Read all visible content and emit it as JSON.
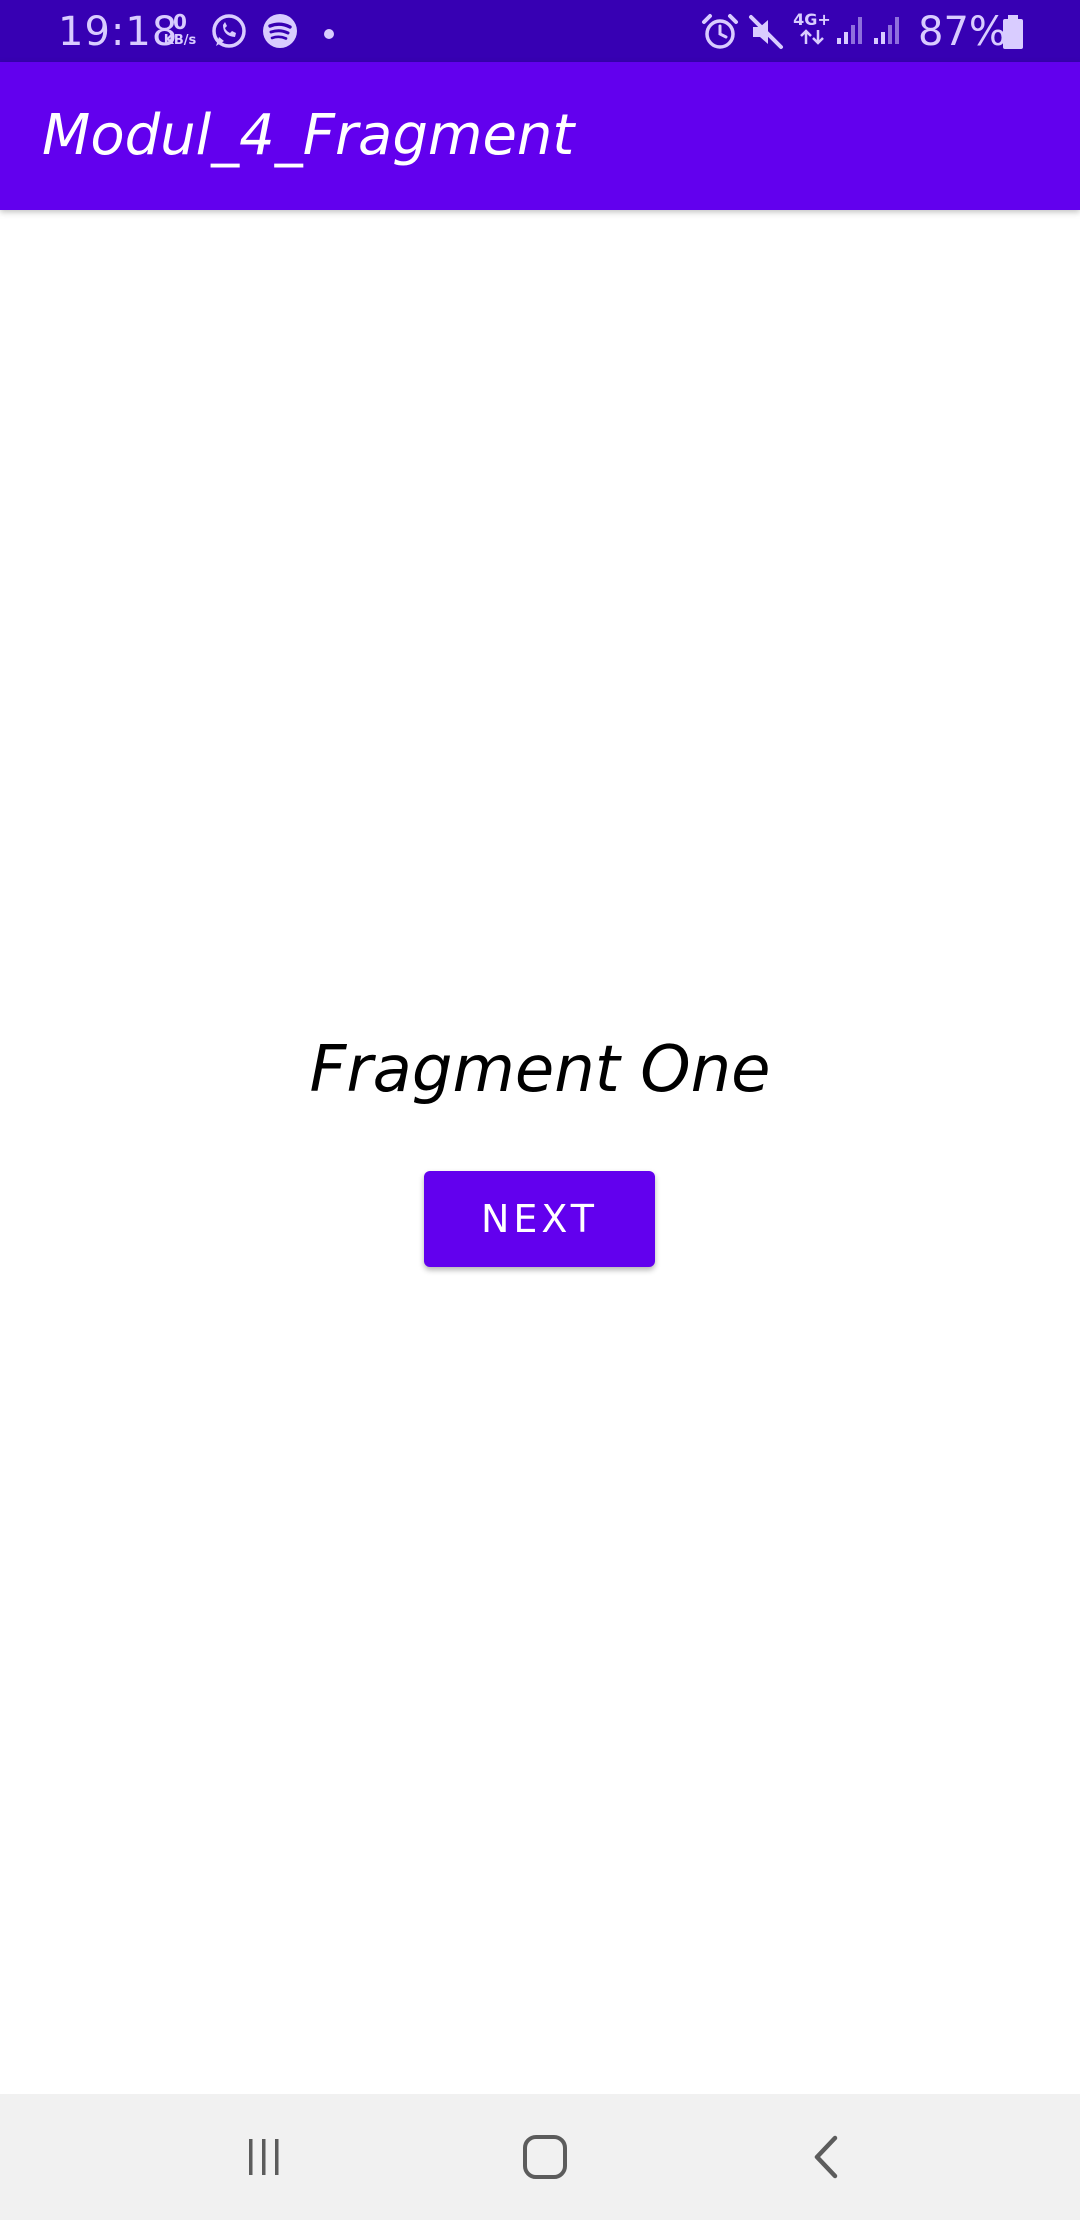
{
  "status_bar": {
    "time": "19:18",
    "net_speed_value": "0",
    "net_speed_unit": "KB/s",
    "network_type": "4G+",
    "battery_percent": "87%",
    "icons": [
      "whatsapp-icon",
      "spotify-icon",
      "dot-icon",
      "alarm-icon",
      "mute-icon",
      "signal-icon",
      "battery-icon"
    ],
    "background_color": "#3700b3"
  },
  "app_bar": {
    "title": "Modul_4_Fragment",
    "background_color": "#6200ee"
  },
  "content": {
    "fragment_label": "Fragment One",
    "next_button_label": "NEXT",
    "button_color": "#6200ee"
  },
  "nav_bar": {
    "buttons": [
      "recent-apps-icon",
      "home-icon",
      "back-icon"
    ],
    "background_color": "#f1f1f1"
  }
}
